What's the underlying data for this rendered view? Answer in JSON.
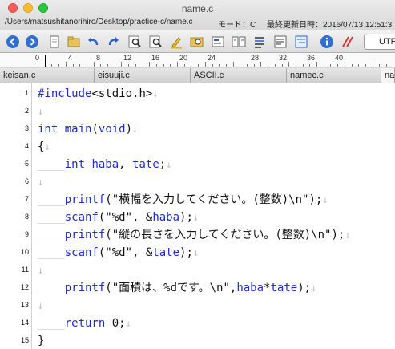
{
  "window": {
    "title": "name.c",
    "path": "/Users/matsushitanorihiro/Desktop/practice-c/name.c",
    "mode": "モード：C",
    "modified": "最終更新日時：2016/07/13 12:51:3"
  },
  "toolbar": {
    "buttons": [
      "back-icon",
      "forward-icon",
      "new-file-icon",
      "open-file-icon",
      "save-icon",
      "undo-icon",
      "redo-icon",
      "find-icon",
      "highlight-icon",
      "find-in-files-icon",
      "replace-icon",
      "compare-icon",
      "format-icon",
      "wrap-icon",
      "info-icon",
      "no-wrap-icon"
    ],
    "encoding": "UTF"
  },
  "ruler": {
    "labels": [
      "0",
      "4",
      "8",
      "12",
      "16",
      "20",
      "24",
      "28",
      "32",
      "36",
      "40"
    ]
  },
  "tabs": [
    {
      "label": "keisan.c",
      "active": false
    },
    {
      "label": "eisuuji.c",
      "active": false
    },
    {
      "label": "ASCII.c",
      "active": false
    },
    {
      "label": "namec.c",
      "active": false
    },
    {
      "label": "na",
      "active": true
    }
  ],
  "editor": {
    "line_numbers": [
      "1",
      "2",
      "3",
      "4",
      "5",
      "6",
      "7",
      "8",
      "9",
      "10",
      "11",
      "12",
      "13",
      "14",
      "15"
    ],
    "lines": [
      "#include<stdio.h>",
      "",
      "int main(void)",
      "{",
      "    int haba, tate;",
      "",
      "    printf(\"横幅を入力してください。(整数)\\n\");",
      "    scanf(\"%d\", &haba);",
      "    printf(\"縦の長さを入力してください。(整数)\\n\");",
      "    scanf(\"%d\", &tate);",
      "",
      "    printf(\"面積は、%dです。\\n\",haba*tate);",
      "",
      "    return 0;",
      "}"
    ],
    "eol_marker": "↓",
    "keyword_color": "#1c2ad6"
  }
}
